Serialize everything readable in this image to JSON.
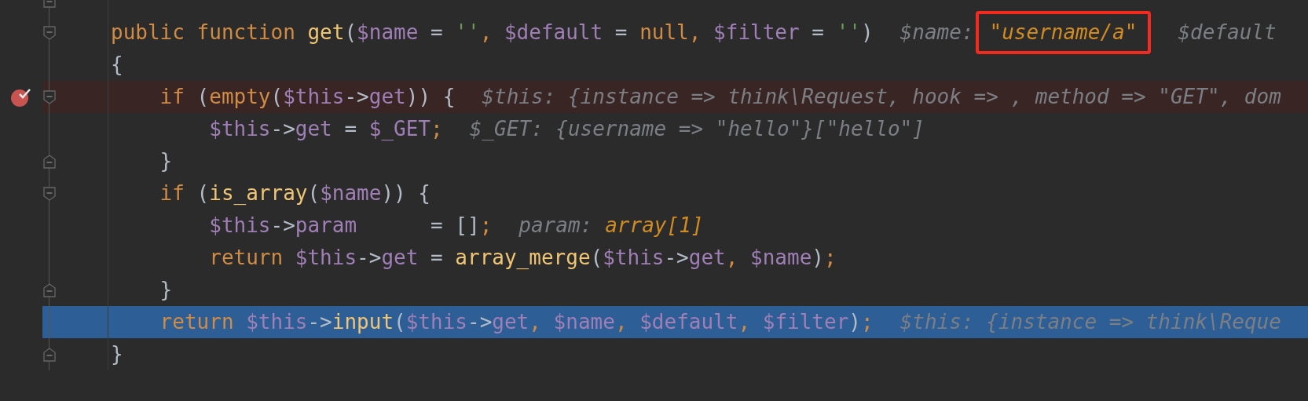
{
  "lines": [
    {
      "fold_open": false,
      "fold_close": true,
      "breakpoint": false,
      "current": false
    },
    {
      "fold_open": true,
      "fold_close": false,
      "breakpoint": false,
      "current": false,
      "tokens": [
        {
          "kind": "keyword",
          "text": "public function "
        },
        {
          "kind": "function",
          "text": "get"
        },
        {
          "kind": "punct",
          "text": "("
        },
        {
          "kind": "variable",
          "text": "$name"
        },
        {
          "kind": "operator",
          "text": " = "
        },
        {
          "kind": "string",
          "text": "''"
        },
        {
          "kind": "comma",
          "text": ", "
        },
        {
          "kind": "variable",
          "text": "$default"
        },
        {
          "kind": "operator",
          "text": " = "
        },
        {
          "kind": "keyword",
          "text": "null"
        },
        {
          "kind": "comma",
          "text": ", "
        },
        {
          "kind": "variable",
          "text": "$filter"
        },
        {
          "kind": "operator",
          "text": " = "
        },
        {
          "kind": "string",
          "text": "''"
        },
        {
          "kind": "punct",
          "text": ")"
        },
        {
          "kind": "hint",
          "text": "$name:"
        },
        {
          "kind": "hint-value",
          "text": "\"username/a\"",
          "boxed": true
        },
        {
          "kind": "hint",
          "text": "$default"
        }
      ]
    },
    {
      "fold_open": false,
      "fold_close": false,
      "breakpoint": false,
      "current": false,
      "tokens": [
        {
          "kind": "punct",
          "text": "{"
        }
      ]
    },
    {
      "fold_open": true,
      "fold_close": false,
      "breakpoint": true,
      "current": false,
      "tokens": [
        {
          "kind": "keyword",
          "text": "    if "
        },
        {
          "kind": "punct",
          "text": "("
        },
        {
          "kind": "keyword",
          "text": "empty"
        },
        {
          "kind": "punct",
          "text": "("
        },
        {
          "kind": "variable",
          "text": "$this"
        },
        {
          "kind": "operator",
          "text": "->"
        },
        {
          "kind": "variable",
          "text": "get"
        },
        {
          "kind": "punct",
          "text": ")) {"
        },
        {
          "kind": "hint",
          "text": "$this: {instance => think\\Request, hook => , method => \"GET\", dom"
        }
      ]
    },
    {
      "fold_open": false,
      "fold_close": false,
      "breakpoint": false,
      "current": false,
      "tokens": [
        {
          "kind": "variable",
          "text": "        $this"
        },
        {
          "kind": "operator",
          "text": "->"
        },
        {
          "kind": "variable",
          "text": "get"
        },
        {
          "kind": "operator",
          "text": " = "
        },
        {
          "kind": "variable",
          "text": "$_GET"
        },
        {
          "kind": "comma",
          "text": ";"
        },
        {
          "kind": "hint",
          "text": "$_GET: {username => \"hello\"}[\"hello\"]"
        }
      ]
    },
    {
      "fold_open": false,
      "fold_close": true,
      "breakpoint": false,
      "current": false,
      "tokens": [
        {
          "kind": "punct",
          "text": "    }"
        }
      ]
    },
    {
      "fold_open": true,
      "fold_close": false,
      "breakpoint": false,
      "current": false,
      "tokens": [
        {
          "kind": "keyword",
          "text": "    if "
        },
        {
          "kind": "punct",
          "text": "("
        },
        {
          "kind": "function",
          "text": "is_array"
        },
        {
          "kind": "punct",
          "text": "("
        },
        {
          "kind": "variable",
          "text": "$name"
        },
        {
          "kind": "punct",
          "text": ")) {"
        }
      ]
    },
    {
      "fold_open": false,
      "fold_close": false,
      "breakpoint": false,
      "current": false,
      "tokens": [
        {
          "kind": "variable",
          "text": "        $this"
        },
        {
          "kind": "operator",
          "text": "->"
        },
        {
          "kind": "variable",
          "text": "param"
        },
        {
          "kind": "operator",
          "text": "      = []"
        },
        {
          "kind": "comma",
          "text": ";"
        },
        {
          "kind": "hint",
          "text": "param:"
        },
        {
          "kind": "hint-value",
          "text": "array[1]",
          "boxed": false
        }
      ]
    },
    {
      "fold_open": false,
      "fold_close": false,
      "breakpoint": false,
      "current": false,
      "tokens": [
        {
          "kind": "keyword",
          "text": "        return "
        },
        {
          "kind": "variable",
          "text": "$this"
        },
        {
          "kind": "operator",
          "text": "->"
        },
        {
          "kind": "variable",
          "text": "get"
        },
        {
          "kind": "operator",
          "text": " = "
        },
        {
          "kind": "function",
          "text": "array_merge"
        },
        {
          "kind": "punct",
          "text": "("
        },
        {
          "kind": "variable",
          "text": "$this"
        },
        {
          "kind": "operator",
          "text": "->"
        },
        {
          "kind": "variable",
          "text": "get"
        },
        {
          "kind": "comma",
          "text": ", "
        },
        {
          "kind": "variable",
          "text": "$name"
        },
        {
          "kind": "punct",
          "text": ")"
        },
        {
          "kind": "comma",
          "text": ";"
        }
      ]
    },
    {
      "fold_open": false,
      "fold_close": true,
      "breakpoint": false,
      "current": false,
      "tokens": [
        {
          "kind": "punct",
          "text": "    }"
        }
      ]
    },
    {
      "fold_open": false,
      "fold_close": false,
      "breakpoint": false,
      "current": true,
      "tokens": [
        {
          "kind": "keyword",
          "text": "    return "
        },
        {
          "kind": "variable",
          "text": "$this"
        },
        {
          "kind": "operator",
          "text": "->"
        },
        {
          "kind": "function",
          "text": "input"
        },
        {
          "kind": "punct",
          "text": "("
        },
        {
          "kind": "variable",
          "text": "$this"
        },
        {
          "kind": "operator",
          "text": "->"
        },
        {
          "kind": "variable",
          "text": "get"
        },
        {
          "kind": "comma",
          "text": ", "
        },
        {
          "kind": "variable",
          "text": "$name"
        },
        {
          "kind": "comma",
          "text": ", "
        },
        {
          "kind": "variable",
          "text": "$default"
        },
        {
          "kind": "comma",
          "text": ", "
        },
        {
          "kind": "variable",
          "text": "$filter"
        },
        {
          "kind": "punct",
          "text": ")"
        },
        {
          "kind": "comma",
          "text": ";"
        },
        {
          "kind": "hint",
          "text": "$this: {instance => think\\Reque"
        }
      ]
    },
    {
      "fold_open": false,
      "fold_close": true,
      "breakpoint": false,
      "current": false,
      "tokens": [
        {
          "kind": "punct",
          "text": "}"
        }
      ]
    }
  ]
}
